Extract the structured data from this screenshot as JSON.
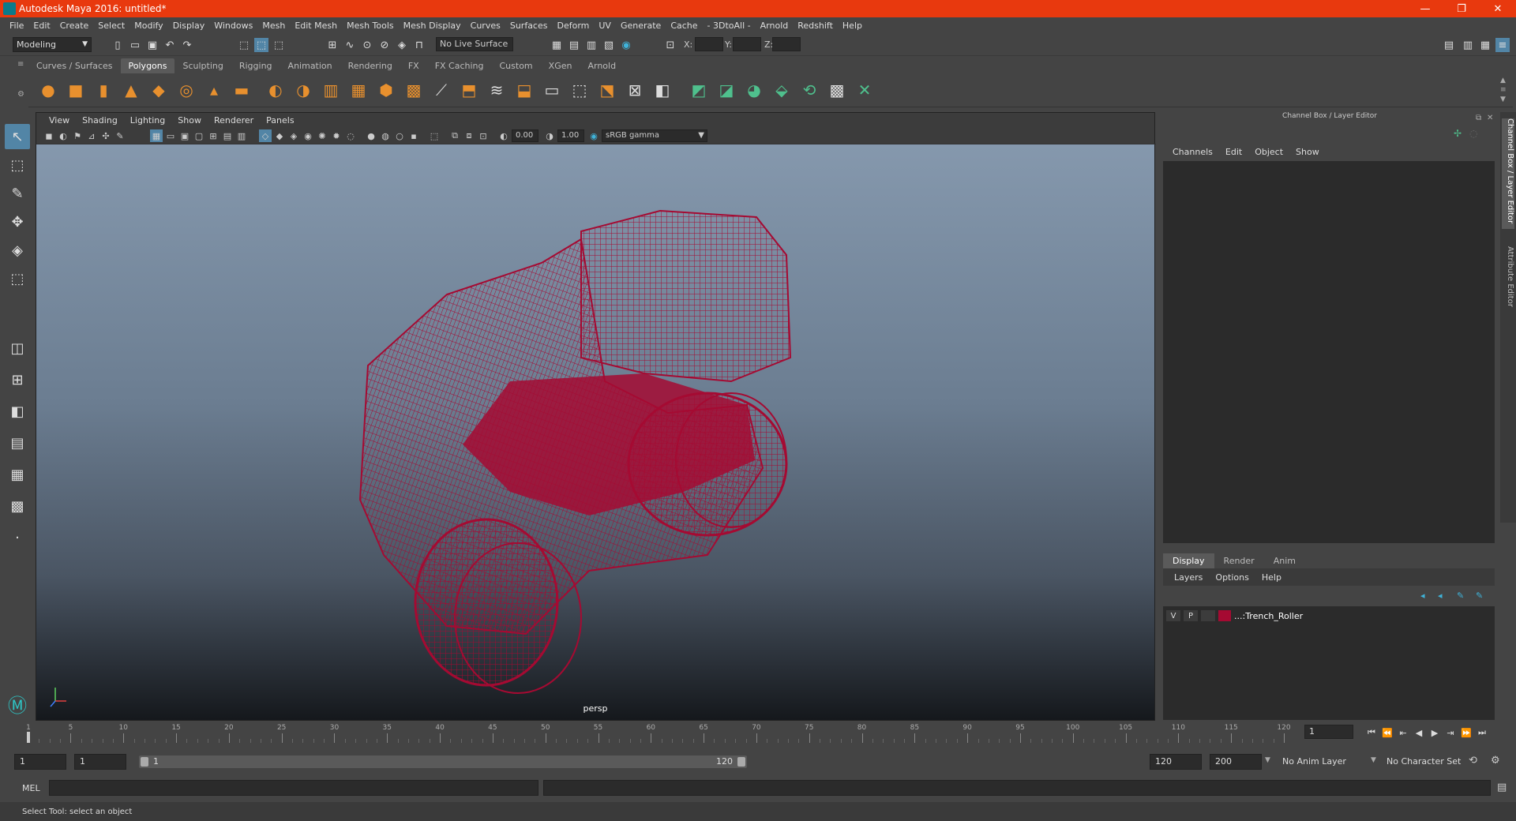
{
  "window": {
    "title": "Autodesk Maya 2016: untitled*",
    "minimize": "—",
    "maximize": "❐",
    "close": "✕"
  },
  "menubar": [
    "File",
    "Edit",
    "Create",
    "Select",
    "Modify",
    "Display",
    "Windows",
    "Mesh",
    "Edit Mesh",
    "Mesh Tools",
    "Mesh Display",
    "Curves",
    "Surfaces",
    "Deform",
    "UV",
    "Generate",
    "Cache",
    "- 3DtoAll -",
    "Arnold",
    "Redshift",
    "Help"
  ],
  "statusline": {
    "mode": "Modeling",
    "live_surface": "No Live Surface",
    "x_label": "X:",
    "y_label": "Y:",
    "z_label": "Z:"
  },
  "shelf_tabs": [
    "Curves / Surfaces",
    "Polygons",
    "Sculpting",
    "Rigging",
    "Animation",
    "Rendering",
    "FX",
    "FX Caching",
    "Custom",
    "XGen",
    "Arnold"
  ],
  "shelf_active": "Polygons",
  "panel_menu": [
    "View",
    "Shading",
    "Lighting",
    "Show",
    "Renderer",
    "Panels"
  ],
  "panel_toolbar": {
    "exposure": "0.00",
    "gamma": "1.00",
    "color_space": "sRGB gamma"
  },
  "viewport": {
    "camera": "persp",
    "wire_color": "#a50a32"
  },
  "channel_box": {
    "header": "Channel Box / Layer Editor",
    "menu": [
      "Channels",
      "Edit",
      "Object",
      "Show"
    ]
  },
  "layer_editor": {
    "tabs": [
      "Display",
      "Render",
      "Anim"
    ],
    "active": "Display",
    "menu": [
      "Layers",
      "Options",
      "Help"
    ],
    "layers": [
      {
        "v": "V",
        "p": "P",
        "color": "#a50a32",
        "name": "...:Trench_Roller"
      }
    ]
  },
  "side_tabs": [
    "Channel Box / Layer Editor",
    "Attribute Editor"
  ],
  "timeline": {
    "ticks": [
      1,
      5,
      10,
      15,
      20,
      25,
      30,
      35,
      40,
      45,
      50,
      55,
      60,
      65,
      70,
      75,
      80,
      85,
      90,
      95,
      100,
      105,
      110,
      115,
      120
    ],
    "current_frame": "1"
  },
  "range": {
    "start": "1",
    "playback_start": "1",
    "slider_start": "1",
    "slider_end": "120",
    "playback_end": "120",
    "end": "200",
    "anim_layer": "No Anim Layer",
    "character_set": "No Character Set"
  },
  "command_line": {
    "label": "MEL"
  },
  "status": {
    "message": "Select Tool: select an object"
  }
}
